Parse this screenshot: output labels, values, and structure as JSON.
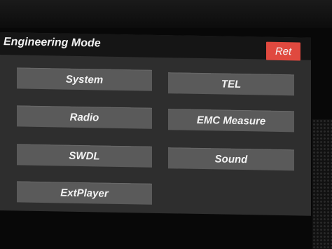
{
  "header": {
    "title": "Engineering Mode",
    "ret_label": "Ret"
  },
  "menu": {
    "system": "System",
    "tel": "TEL",
    "radio": "Radio",
    "emc_measure": "EMC Measure",
    "swdl": "SWDL",
    "sound": "Sound",
    "extplayer": "ExtPlayer"
  },
  "colors": {
    "screen_bg": "#2e2e2e",
    "title_bar_bg": "#151515",
    "button_bg": "#5a5a5a",
    "ret_button_bg": "#e0493f",
    "text": "#f3f3f3"
  }
}
